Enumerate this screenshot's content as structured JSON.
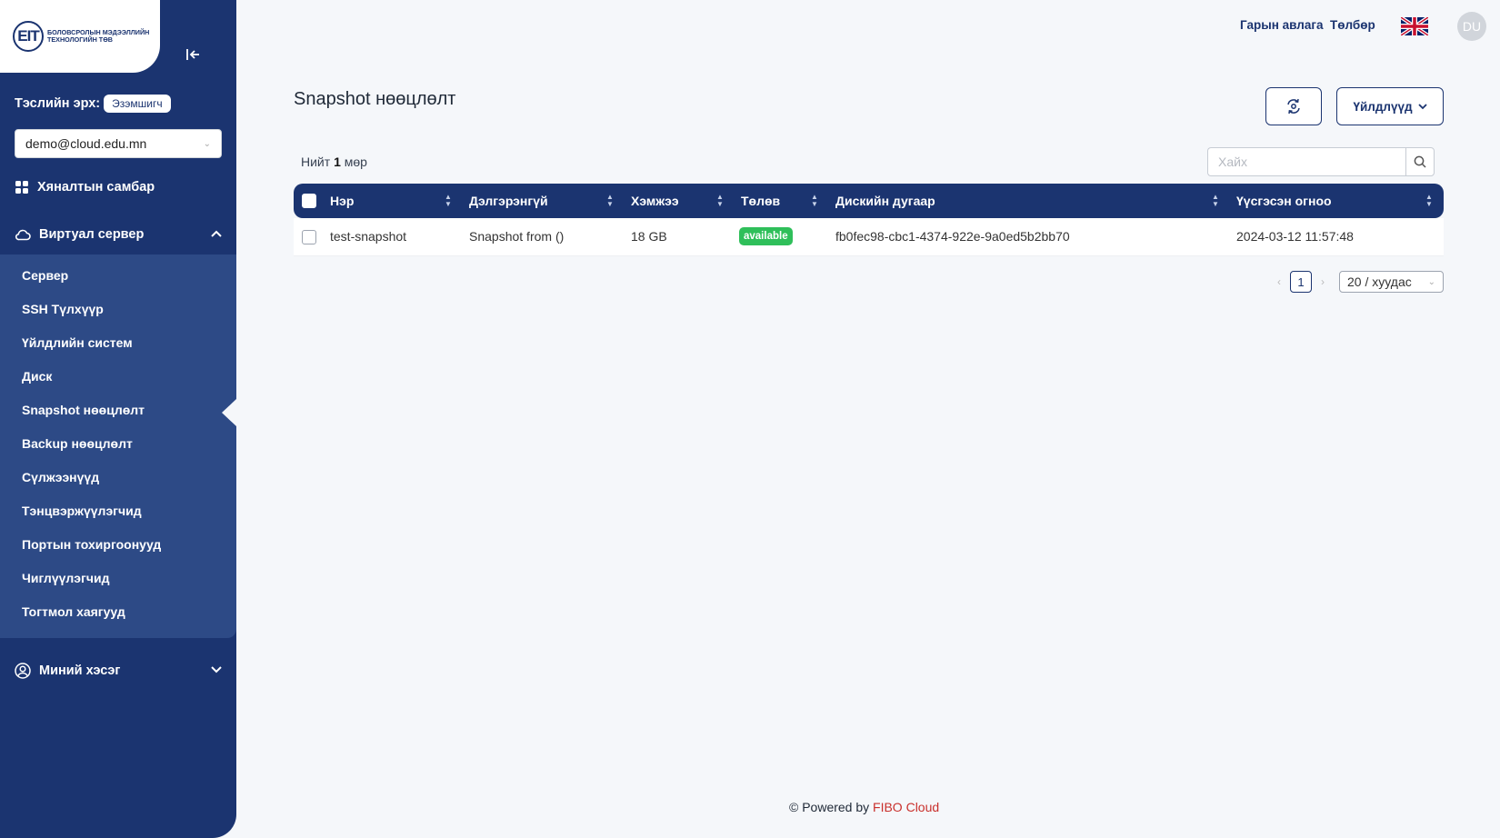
{
  "logo": {
    "mark": "EIT",
    "text": "Боловсролын мэдээллийн технологийн төв"
  },
  "sidebar": {
    "role_label": "Тэслийн эрх:",
    "role_badge": "Эзэмшигч",
    "account": "demo@cloud.edu.mn",
    "dashboard": "Хяналтын самбар",
    "virtual_server": "Виртуал сервер",
    "sub_items": [
      {
        "label": "Сервер"
      },
      {
        "label": "SSH Түлхүүр"
      },
      {
        "label": "Үйлдлийн систем"
      },
      {
        "label": "Диск"
      },
      {
        "label": "Snapshot нөөцлөлт"
      },
      {
        "label": "Backup нөөцлөлт"
      },
      {
        "label": "Сүлжээнүүд"
      },
      {
        "label": "Тэнцвэржүүлэгчид"
      },
      {
        "label": "Портын тохиргоонууд"
      },
      {
        "label": "Чиглүүлэгчид"
      },
      {
        "label": "Тогтмол хаягууд"
      }
    ],
    "my_section": "Миний хэсэг"
  },
  "topbar": {
    "manual": "Гарын авлага",
    "payment": "Төлбөр",
    "avatar": "DU"
  },
  "page": {
    "title": "Snapshot нөөцлөлт",
    "actions_label": "Үйлдлүүд",
    "total_prefix": "Нийт",
    "total_count": "1",
    "total_suffix": "мөр",
    "search_placeholder": "Хайх"
  },
  "table": {
    "columns": [
      "Нэр",
      "Дэлгэрэнгүй",
      "Хэмжээ",
      "Төлөв",
      "Дискийн дугаар",
      "Үүсгэсэн огноо"
    ],
    "rows": [
      {
        "name": "test-snapshot",
        "description": "Snapshot from ()",
        "size": "18 GB",
        "status": "available",
        "disk_id": "fb0fec98-cbc1-4374-922e-9a0ed5b2bb70",
        "created": "2024-03-12 11:57:48"
      }
    ]
  },
  "pagination": {
    "current": "1",
    "page_size": "20 / хуудас"
  },
  "footer": {
    "prefix": "© Powered by",
    "brand": "FIBO Cloud"
  },
  "colors": {
    "sidebar": "#1b3470",
    "submenu": "#2d4a86",
    "status_ok": "#2fbf5a",
    "brand_red": "#c9302c"
  }
}
